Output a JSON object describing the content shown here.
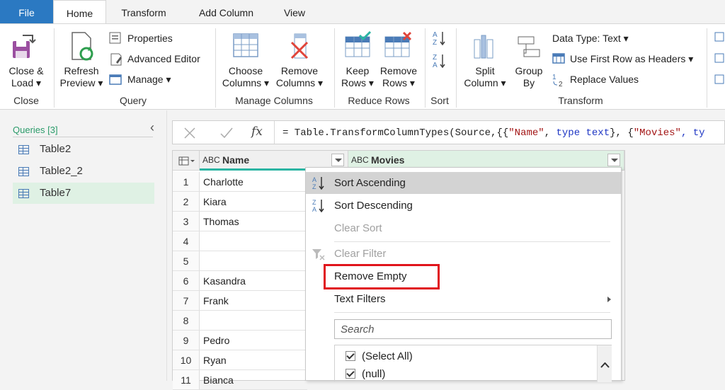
{
  "tabs": [
    "File",
    "Home",
    "Transform",
    "Add Column",
    "View"
  ],
  "ribbon": {
    "close_group": {
      "label": "Close",
      "close_load": "Close &",
      "close_load_2": "Load ▾"
    },
    "query_group": {
      "label": "Query",
      "refresh": "Refresh",
      "refresh_2": "Preview ▾",
      "properties": "Properties",
      "advanced_editor": "Advanced Editor",
      "manage": "Manage ▾"
    },
    "manage_columns_group": {
      "label": "Manage Columns",
      "choose": "Choose",
      "choose_2": "Columns ▾",
      "remove": "Remove",
      "remove_2": "Columns ▾"
    },
    "reduce_rows_group": {
      "label": "Reduce Rows",
      "keep": "Keep",
      "keep_2": "Rows ▾",
      "remove": "Remove",
      "remove_2": "Rows ▾"
    },
    "sort_group": {
      "label": "Sort"
    },
    "transform_group": {
      "label": "Transform",
      "split": "Split",
      "split_2": "Column ▾",
      "group": "Group",
      "group_2": "By",
      "data_type": "Data Type: Text ▾",
      "first_row": "Use First Row as Headers ▾",
      "replace": "Replace Values"
    }
  },
  "queries": {
    "header": "Queries [3]",
    "items": [
      "Table2",
      "Table2_2",
      "Table7"
    ],
    "selected": "Table7"
  },
  "formula": {
    "prefix": "= Table.TransformColumnTypes(Source,{{",
    "s1": "\"Name\"",
    "m1": ", ",
    "k1": "type text",
    "m2": "}, {",
    "s2": "\"Movies\"",
    "m3": ", ty"
  },
  "grid": {
    "columns": [
      {
        "type": "ABC",
        "name": "Name"
      },
      {
        "type": "ABC",
        "name": "Movies"
      }
    ],
    "rows": [
      {
        "n": "1",
        "name": "Charlotte"
      },
      {
        "n": "2",
        "name": "Kiara"
      },
      {
        "n": "3",
        "name": "Thomas"
      },
      {
        "n": "4",
        "name": ""
      },
      {
        "n": "5",
        "name": ""
      },
      {
        "n": "6",
        "name": "Kasandra"
      },
      {
        "n": "7",
        "name": "Frank"
      },
      {
        "n": "8",
        "name": ""
      },
      {
        "n": "9",
        "name": "Pedro"
      },
      {
        "n": "10",
        "name": "Ryan"
      },
      {
        "n": "11",
        "name": "Bianca"
      }
    ]
  },
  "menu": {
    "sort_asc": "Sort Ascending",
    "sort_desc": "Sort Descending",
    "clear_sort": "Clear Sort",
    "clear_filter": "Clear Filter",
    "remove_empty": "Remove Empty",
    "text_filters": "Text Filters",
    "search_placeholder": "Search",
    "checklist": [
      {
        "label": "(Select All)",
        "checked": true
      },
      {
        "label": "(null)",
        "checked": true
      }
    ]
  },
  "colors": {
    "file_tab": "#2b79c2",
    "highlight_box": "#e0141c",
    "selected_query": "#dff1e4",
    "name_column_accent": "#2bb5a3"
  }
}
